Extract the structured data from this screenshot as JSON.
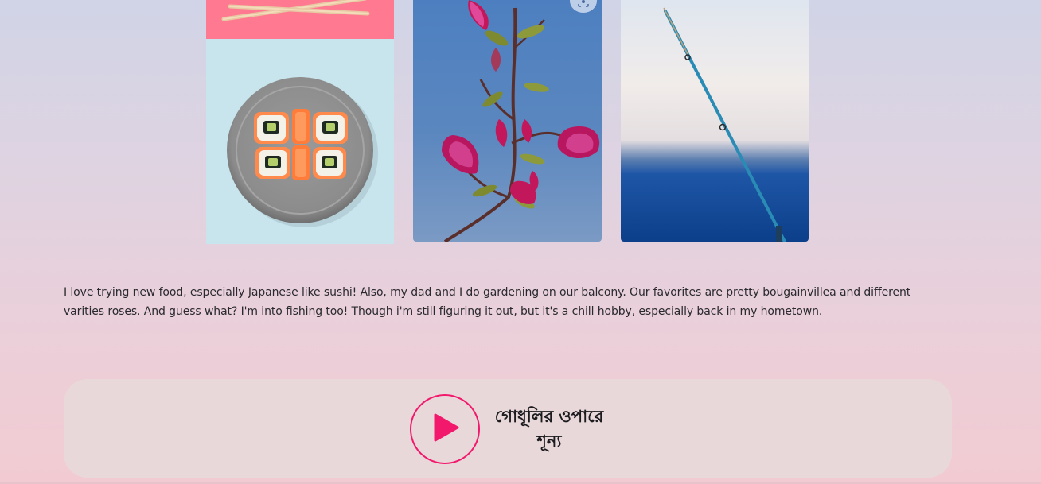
{
  "gallery": {
    "photos": [
      {
        "name": "chopsticks-photo",
        "subject": "chopsticks on pink background"
      },
      {
        "name": "sushi-photo",
        "subject": "sushi rolls on grey plate"
      },
      {
        "name": "bougainvillea-photo",
        "subject": "pink bougainvillea branch against blue sky"
      },
      {
        "name": "fishing-photo",
        "subject": "fishing rod over the sea"
      }
    ],
    "lens_icon": "visual-search-icon"
  },
  "about": {
    "line1": "I love trying new food, especially Japanese like sushi! Also, my dad and I do gardening on our balcony. Our favorites are pretty bougainvillea and different",
    "line2": "varities roses. And guess what? I'm into fishing too! Though i'm still figuring it out, but it's a chill hobby, especially back in my hometown."
  },
  "music": {
    "title_line1": "গোধূলির ওপারে",
    "title_line2": "শূন্য",
    "play_icon": "play-icon"
  },
  "colors": {
    "accent": "#f2186c",
    "card_bg": "#e8d9d9",
    "chopsticks_bg": "#ff7a90",
    "sushi_bg": "#c8e4ec",
    "sky_blue": "#5b87bf"
  }
}
